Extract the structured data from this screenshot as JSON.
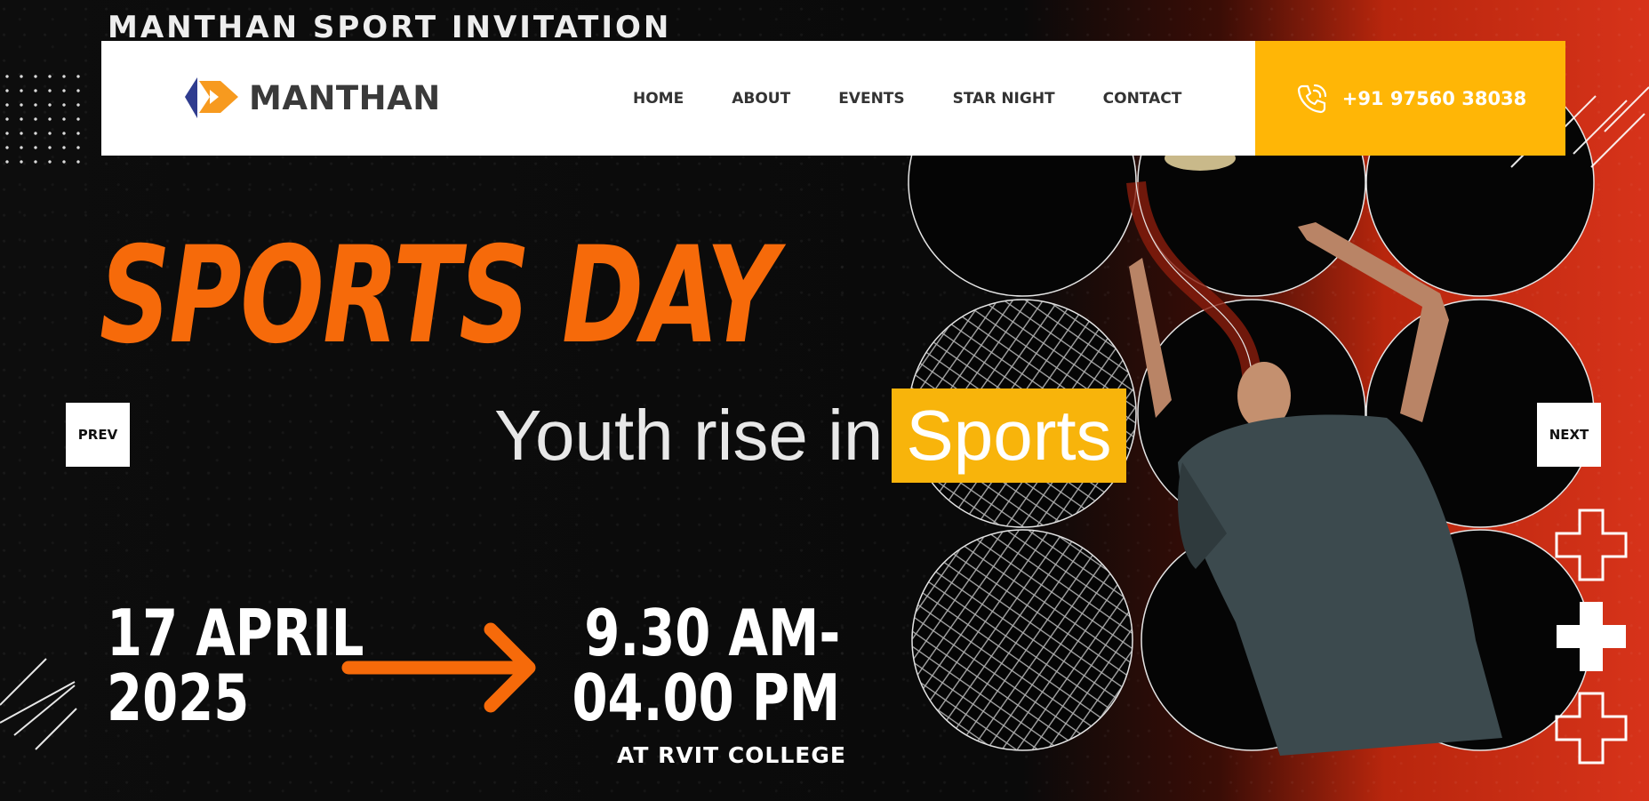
{
  "invitation_title": "MANTHAN SPORT INVITATION",
  "logo": {
    "text": "MANTHAN",
    "colors": {
      "blue": "#2f3c8f",
      "orange": "#f79a1f"
    }
  },
  "nav": {
    "items": [
      {
        "label": "HOME"
      },
      {
        "label": "ABOUT"
      },
      {
        "label": "EVENTS"
      },
      {
        "label": "STAR NIGHT"
      },
      {
        "label": "CONTACT"
      }
    ]
  },
  "contact": {
    "phone": "+91 97560 38038",
    "icon": "phone-ring-icon"
  },
  "hero": {
    "headline": "SPORTS DAY",
    "subtitle_prefix": "Youth rise in",
    "subtitle_highlight": "Sports",
    "date_line1": "17 APRIL",
    "date_line2": "2025",
    "time_line1": "9.30 AM-",
    "time_line2": "04.00 PM",
    "venue": "AT RVIT COLLEGE"
  },
  "slider": {
    "prev_label": "PREV",
    "next_label": "NEXT"
  },
  "colors": {
    "accent_orange": "#f66a0a",
    "accent_yellow": "#ffb606",
    "background": "#0b0b0b",
    "gradient_red": "#d7331a"
  }
}
